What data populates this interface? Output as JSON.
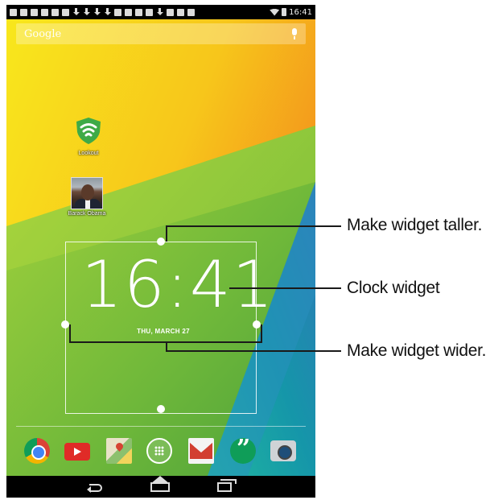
{
  "status_bar": {
    "time": "16:41"
  },
  "search": {
    "logo_text": "Google"
  },
  "desktop": {
    "lookout_label": "Lookout",
    "contact_label": "Barack Obama"
  },
  "clock_widget": {
    "time": "16:41",
    "date": "THU, MARCH 27"
  },
  "callouts": {
    "taller": "Make widget taller.",
    "clock": "Clock widget",
    "wider": "Make widget wider."
  },
  "colors": {
    "wallpaper_yellow": "#f6d21a",
    "wallpaper_orange": "#f39a1e",
    "wallpaper_green": "#8cc63f",
    "wallpaper_blue": "#1a6fb0",
    "lookout_green": "#3eaa47"
  }
}
